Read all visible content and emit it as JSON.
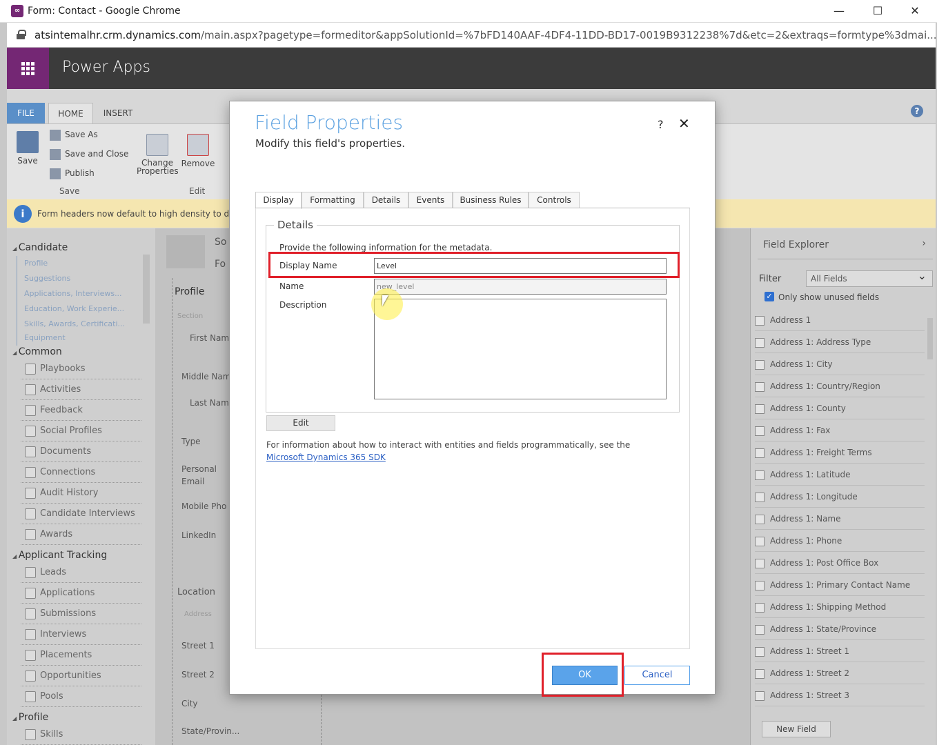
{
  "window": {
    "title": "Form: Contact - Google Chrome",
    "app_icon": "dynamics-icon",
    "minimize": "—",
    "maximize": "☐",
    "close": "✕"
  },
  "address_bar": {
    "host": "atsintemalhr.crm.dynamics.com",
    "path": "/main.aspx?pagetype=formeditor&appSolutionId=%7bFD140AAF-4DF4-11DD-BD17-0019B9312238%7d&etc=2&extraqs=formtype%3dmai..."
  },
  "app_header": {
    "app_name": "Power Apps"
  },
  "ribbon": {
    "tabs": [
      "FILE",
      "HOME",
      "INSERT"
    ],
    "save": "Save",
    "save_as": "Save As",
    "save_and_close": "Save and Close",
    "publish": "Publish",
    "save_group": "Save",
    "change_properties_1": "Change",
    "change_properties_2": "Properties",
    "remove": "Remove",
    "edit_group": "Edit",
    "help": "?"
  },
  "notice": {
    "icon": "i",
    "text": "Form headers now default to high density to dis"
  },
  "left_nav": {
    "candidate_section": "Candidate",
    "candidate_items": [
      "Profile",
      "Suggestions",
      "Applications, Interviews...",
      "Education, Work Experie...",
      "Skills, Awards, Certificati...",
      "Equipment"
    ],
    "common_section": "Common",
    "common_items": [
      "Playbooks",
      "Activities",
      "Feedback",
      "Social Profiles",
      "Documents",
      "Connections",
      "Audit History",
      "Candidate Interviews",
      "Awards"
    ],
    "applicant_section": "Applicant Tracking",
    "applicant_items": [
      "Leads",
      "Applications",
      "Submissions",
      "Interviews",
      "Placements",
      "Opportunities",
      "Pools"
    ],
    "profile_section": "Profile",
    "profile_items": [
      "Skills"
    ]
  },
  "form_area": {
    "header_so": "So",
    "header_fo": "Fo",
    "profile_section": "Profile",
    "section_tag": "Section",
    "fields": [
      "First Nam",
      "Middle Nam",
      "Last Nam",
      "Type",
      "Personal Email",
      "Mobile Pho",
      "LinkedIn"
    ],
    "location_section": "Location",
    "location_fields": [
      "Address",
      "Street 1",
      "Street 2",
      "City",
      "State/Provin..."
    ]
  },
  "field_explorer": {
    "title": "Field Explorer",
    "filter_label": "Filter",
    "filter_value": "All Fields",
    "only_unused_label": "Only show unused fields",
    "fields": [
      "Address 1",
      "Address 1: Address Type",
      "Address 1: City",
      "Address 1: Country/Region",
      "Address 1: County",
      "Address 1: Fax",
      "Address 1: Freight Terms",
      "Address 1: Latitude",
      "Address 1: Longitude",
      "Address 1: Name",
      "Address 1: Phone",
      "Address 1: Post Office Box",
      "Address 1: Primary Contact Name",
      "Address 1: Shipping Method",
      "Address 1: State/Province",
      "Address 1: Street 1",
      "Address 1: Street 2",
      "Address 1: Street 3"
    ],
    "new_field": "New Field"
  },
  "dialog": {
    "title": "Field Properties",
    "subtitle": "Modify this field's properties.",
    "help": "?",
    "close": "✕",
    "tabs": [
      "Display",
      "Formatting",
      "Details",
      "Events",
      "Business Rules",
      "Controls"
    ],
    "details_legend": "Details",
    "provide_text": "Provide the following information for the metadata.",
    "display_name_label": "Display Name",
    "display_name_value": "Level",
    "name_label": "Name",
    "name_value": "new_level",
    "description_label": "Description",
    "description_value": "",
    "edit_button": "Edit",
    "info_text": "For information about how to interact with entities and fields programmatically, see the ",
    "info_link": "Microsoft Dynamics 365 SDK",
    "ok": "OK",
    "cancel": "Cancel"
  },
  "colors": {
    "accent": "#5aa0e0",
    "highlight_box": "#e0202a",
    "app_purple": "#742774"
  }
}
